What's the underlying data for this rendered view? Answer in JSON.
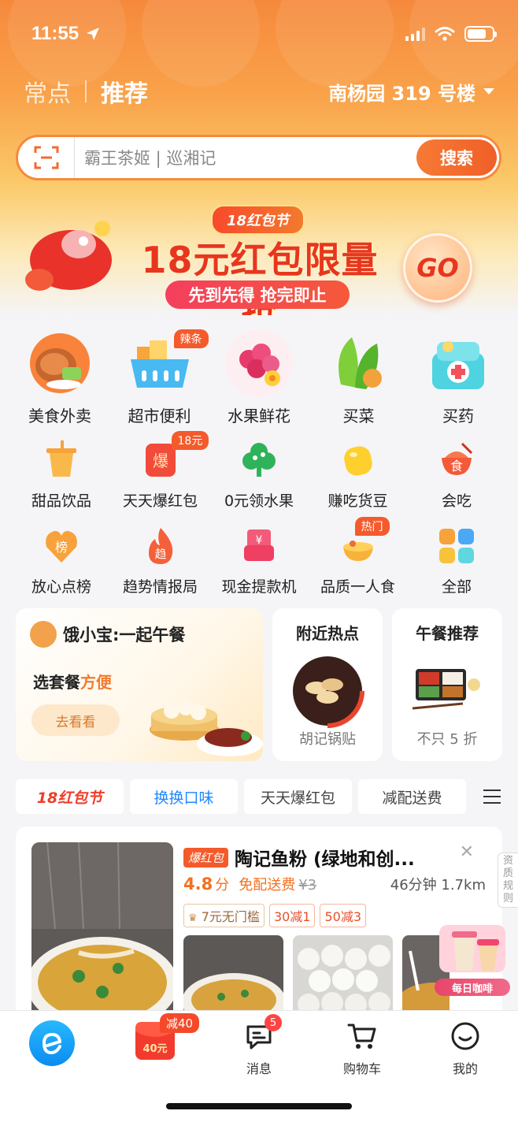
{
  "status_bar": {
    "time": "11:55"
  },
  "top_nav": {
    "tab_frequent": "常点",
    "tab_recommend": "推荐",
    "address": "南杨园 319 号楼"
  },
  "search": {
    "placeholder": "霸王茶姬 | 巡湘记",
    "button": "搜索"
  },
  "banner": {
    "tag": "18红包节",
    "title": "18元红包限量抢",
    "subtitle": "先到先得 抢完即止",
    "go": "GO"
  },
  "categories_main": [
    {
      "label": "美食外卖",
      "icon": "food-delivery-icon"
    },
    {
      "label": "超市便利",
      "icon": "supermarket-icon",
      "badge": "辣条"
    },
    {
      "label": "水果鲜花",
      "icon": "fruit-flower-icon"
    },
    {
      "label": "买菜",
      "icon": "vegetable-icon"
    },
    {
      "label": "买药",
      "icon": "medicine-icon"
    }
  ],
  "categories_row2": [
    {
      "label": "甜品饮品",
      "icon": "drink-icon"
    },
    {
      "label": "天天爆红包",
      "icon": "red-packet-icon",
      "badge": "18元"
    },
    {
      "label": "0元领水果",
      "icon": "tree-icon"
    },
    {
      "label": "赚吃货豆",
      "icon": "bean-icon"
    },
    {
      "label": "会吃",
      "icon": "eat-icon"
    }
  ],
  "categories_row3": [
    {
      "label": "放心点榜",
      "icon": "ranking-icon"
    },
    {
      "label": "趋势情报局",
      "icon": "trend-icon"
    },
    {
      "label": "现金提款机",
      "icon": "cash-machine-icon"
    },
    {
      "label": "品质一人食",
      "icon": "single-meal-icon",
      "badge": "热门"
    },
    {
      "label": "全部",
      "icon": "grid-icon"
    }
  ],
  "promo_main": {
    "title": "饿小宝:一起午餐",
    "line_prefix": "选套餐",
    "line_highlight": "方便",
    "button": "去看看"
  },
  "promo_nearby": {
    "title": "附近热点",
    "sub": "胡记锅贴"
  },
  "promo_lunch": {
    "title": "午餐推荐",
    "sub": "不只 5 折"
  },
  "filters": [
    "18红包节",
    "换换口味",
    "天天爆红包",
    "减配送费"
  ],
  "store": {
    "tag": "爆红包",
    "name": "陶记鱼粉 (绿地和创...",
    "rating": "4.8",
    "rating_unit": "分",
    "free_delivery": "免配送费",
    "old_fee": "¥3",
    "distance": "46分钟 1.7km",
    "tags": [
      "7元无门槛",
      "30减1",
      "50减3"
    ]
  },
  "side_note": "资质规则",
  "coffee": {
    "label": "每日咖啡"
  },
  "tabbar": {
    "redpacket_badge": "减40",
    "redpacket_amount": "40元",
    "message_count": "5",
    "messages": "消息",
    "cart": "购物车",
    "mine": "我的"
  },
  "colors": {
    "brand_orange": "#f6893c",
    "accent_red": "#e8361e",
    "blue": "#1e88ff"
  }
}
